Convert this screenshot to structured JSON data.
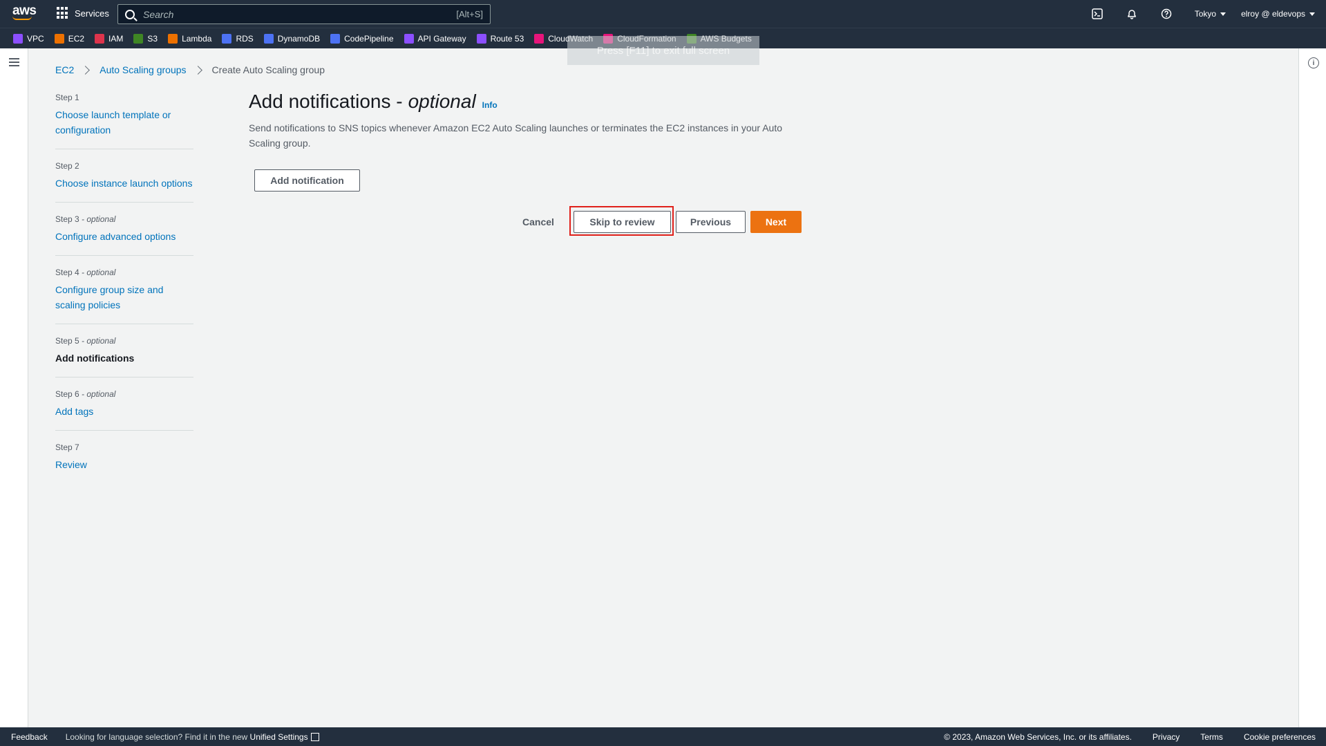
{
  "topbar": {
    "logo_text": "aws",
    "services_label": "Services",
    "search_placeholder": "Search",
    "search_hint": "[Alt+S]",
    "region": "Tokyo",
    "user": "elroy @ eldevops"
  },
  "favorites": [
    {
      "label": "VPC",
      "color": "#8c4fff",
      "icon": "vpc-icon"
    },
    {
      "label": "EC2",
      "color": "#ed7100",
      "icon": "ec2-icon"
    },
    {
      "label": "IAM",
      "color": "#dd344c",
      "icon": "iam-icon"
    },
    {
      "label": "S3",
      "color": "#3f8624",
      "icon": "s3-icon"
    },
    {
      "label": "Lambda",
      "color": "#ed7100",
      "icon": "lambda-icon"
    },
    {
      "label": "RDS",
      "color": "#4d72f3",
      "icon": "rds-icon"
    },
    {
      "label": "DynamoDB",
      "color": "#4d72f3",
      "icon": "dynamodb-icon"
    },
    {
      "label": "CodePipeline",
      "color": "#4d72f3",
      "icon": "codepipeline-icon"
    },
    {
      "label": "API Gateway",
      "color": "#8c4fff",
      "icon": "api-gateway-icon"
    },
    {
      "label": "Route 53",
      "color": "#8c4fff",
      "icon": "route53-icon"
    },
    {
      "label": "CloudWatch",
      "color": "#e7157b",
      "icon": "cloudwatch-icon"
    },
    {
      "label": "CloudFormation",
      "color": "#e7157b",
      "icon": "cloudformation-icon"
    },
    {
      "label": "AWS Budgets",
      "color": "#3f8624",
      "icon": "budgets-icon"
    }
  ],
  "toast": "Press [F11] to exit full screen",
  "breadcrumb": {
    "item1": "EC2",
    "item2": "Auto Scaling groups",
    "current": "Create Auto Scaling group"
  },
  "steps": [
    {
      "num": "Step 1",
      "optional": "",
      "label": "Choose launch template or configuration"
    },
    {
      "num": "Step 2",
      "optional": "",
      "label": "Choose instance launch options"
    },
    {
      "num": "Step 3",
      "optional": " - optional",
      "label": "Configure advanced options"
    },
    {
      "num": "Step 4",
      "optional": " - optional",
      "label": "Configure group size and scaling policies"
    },
    {
      "num": "Step 5",
      "optional": " - optional",
      "label": "Add notifications"
    },
    {
      "num": "Step 6",
      "optional": " - optional",
      "label": "Add tags"
    },
    {
      "num": "Step 7",
      "optional": "",
      "label": "Review"
    }
  ],
  "main": {
    "title": "Add notifications -",
    "title_optional": "optional",
    "info": "Info",
    "description": "Send notifications to SNS topics whenever Amazon EC2 Auto Scaling launches or terminates the EC2 instances in your Auto Scaling group.",
    "add_notification": "Add notification",
    "cancel": "Cancel",
    "skip_to_review": "Skip to review",
    "previous": "Previous",
    "next": "Next"
  },
  "footer": {
    "feedback": "Feedback",
    "lang_text": "Looking for language selection? Find it in the new ",
    "unified_settings": "Unified Settings",
    "copyright": "© 2023, Amazon Web Services, Inc. or its affiliates.",
    "privacy": "Privacy",
    "terms": "Terms",
    "cookie": "Cookie preferences"
  },
  "colors": {
    "nav_bg": "#232f3e",
    "link": "#0073bb",
    "primary": "#ec7211",
    "highlight": "#e0201a"
  }
}
